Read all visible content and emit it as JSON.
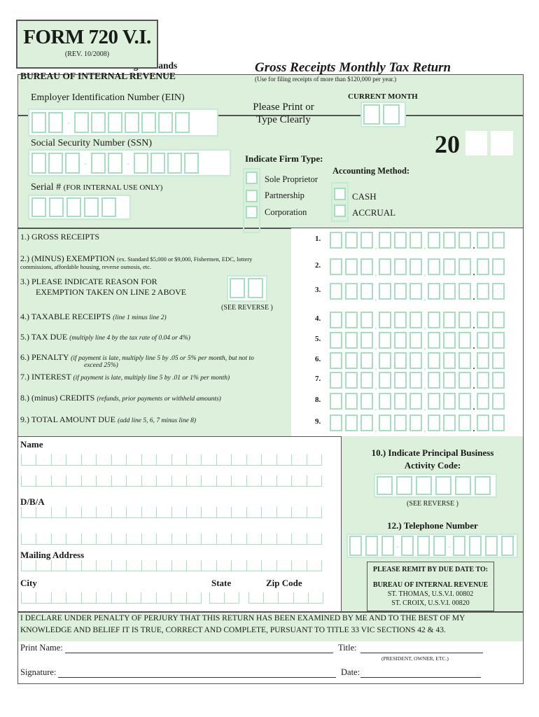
{
  "form": {
    "title": "FORM 720 V.I.",
    "revision": "(REV. 10/2008)"
  },
  "header": {
    "gov": "Government of the U. S.  Virgin Islands",
    "bureau": "BUREAU OF INTERNAL REVENUE",
    "return_title": "Gross Receipts Monthly Tax Return",
    "return_sub": "(Use for filing receipts of more than $120,000 per year.)"
  },
  "top": {
    "ein_label": "Employer Identification Number (EIN)",
    "ssn_label": "Social Security Number (SSN)",
    "serial_label": "Serial #",
    "serial_note": "(FOR INTERNAL USE ONLY)",
    "print_line1": "Please Print or",
    "print_line2": "Type Clearly",
    "current_month": "CURRENT MONTH",
    "year_prefix": "20",
    "firm_type_label": "Indicate Firm Type:",
    "firm_types": [
      "Sole Proprietor",
      "Partnership",
      "Corporation"
    ],
    "accounting_label": "Accounting Method:",
    "accounting_methods": [
      "CASH",
      "ACCRUAL"
    ]
  },
  "lines": [
    {
      "num": "1.",
      "label": "1.)  GROSS RECEIPTS",
      "note": ""
    },
    {
      "num": "2.",
      "label": "2.)  (MINUS) EXEMPTION",
      "note": "(ex. Standard $5,000 or $9,000, Fishermen, EDC, lottery",
      "note2": "commissions, affordable housing, reverse osmosis, etc."
    },
    {
      "num": "3.",
      "label": "3.)  PLEASE INDICATE REASON FOR",
      "label2": "EXEMPTION TAKEN ON LINE 2 ABOVE",
      "see": "(SEE REVERSE )"
    },
    {
      "num": "4.",
      "label": "4.)  TAXABLE RECEIPTS",
      "note": "(line 1 minus line 2)"
    },
    {
      "num": "5.",
      "label": "5.)  TAX DUE",
      "note": "(multiply line 4 by the tax rate of 0.04 or 4%)"
    },
    {
      "num": "6.",
      "label": "6.)  PENALTY",
      "note": "(if payment is late, multiply line 5 by .05 or 5% per month, but not to",
      "note2": "exceed 25%)"
    },
    {
      "num": "7.",
      "label": "7.)  INTEREST",
      "note": "(if payment is late, multiply line 5 by .01 or 1% per month)"
    },
    {
      "num": "8.",
      "label": "8.)  (minus) CREDITS",
      "note": "(refunds, prior payments or withheld amounts)"
    },
    {
      "num": "9.",
      "label": "9.)  TOTAL AMOUNT DUE",
      "note": "(add line 5, 6, 7 minus line 8)"
    }
  ],
  "info": {
    "name": "Name",
    "dba": "D/B/A",
    "mailing": "Mailing Address",
    "city": "City",
    "state": "State",
    "zip": "Zip Code"
  },
  "right": {
    "activity1": "10.) Indicate Principal Business",
    "activity2": "Activity Code:",
    "see": "(SEE REVERSE )",
    "phone": "12.) Telephone Number",
    "remit_title": "PLEASE REMIT BY DUE DATE TO:",
    "remit_bureau": "BUREAU OF INTERNAL REVENUE",
    "remit_st_thomas": "ST. THOMAS, U.S.V.I. 00802",
    "remit_st_croix": "ST. CROIX, U.S.V.I.  00820"
  },
  "declaration": {
    "line1": "I DECLARE UNDER PENALTY OF PERJURY THAT THIS RETURN HAS BEEN EXAMINED BY ME AND TO THE BEST OF MY",
    "line2": "KNOWLEDGE AND BELIEF IT IS TRUE, CORRECT AND COMPLETE, PURSUANT TO TITLE 33 VIC SECTIONS 42 & 43.",
    "print_name": "Print Name:",
    "title": "Title:",
    "title_note": "(PRESIDENT, OWNER, ETC.)",
    "signature": "Signature:",
    "date": "Date:"
  },
  "colors": {
    "panel": "#dcf0dc",
    "box_border": "#a6dec0"
  }
}
